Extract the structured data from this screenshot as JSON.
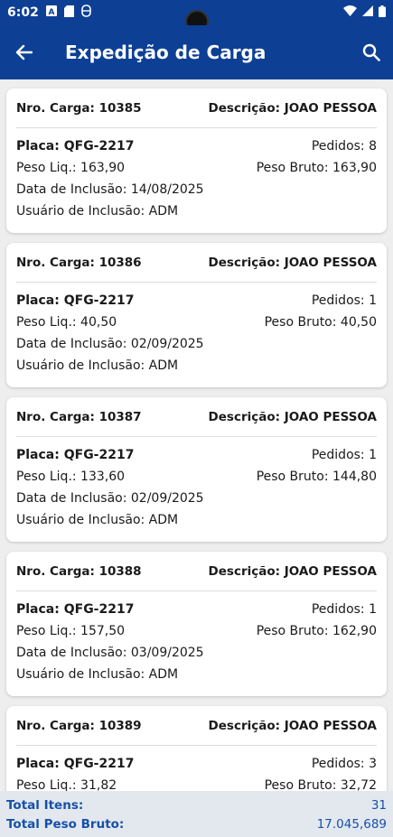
{
  "status": {
    "time": "6:02"
  },
  "header": {
    "title": "Expedição de Carga"
  },
  "cards": [
    {
      "carga": "Nro. Carga: 10385",
      "descricao": "Descrição: JOAO PESSOA",
      "placa": "Placa: QFG-2217",
      "pedidos": "Pedidos: 8",
      "peso_liq": "Peso Liq.: 163,90",
      "peso_bruto": "Peso Bruto: 163,90",
      "data": "Data de Inclusão: 14/08/2025",
      "usuario": "Usuário de Inclusão: ADM"
    },
    {
      "carga": "Nro. Carga: 10386",
      "descricao": "Descrição: JOAO PESSOA",
      "placa": "Placa: QFG-2217",
      "pedidos": "Pedidos: 1",
      "peso_liq": "Peso Liq.: 40,50",
      "peso_bruto": "Peso Bruto: 40,50",
      "data": "Data de Inclusão: 02/09/2025",
      "usuario": "Usuário de Inclusão: ADM"
    },
    {
      "carga": "Nro. Carga: 10387",
      "descricao": "Descrição: JOAO PESSOA",
      "placa": "Placa: QFG-2217",
      "pedidos": "Pedidos: 1",
      "peso_liq": "Peso Liq.: 133,60",
      "peso_bruto": "Peso Bruto: 144,80",
      "data": "Data de Inclusão: 02/09/2025",
      "usuario": "Usuário de Inclusão: ADM"
    },
    {
      "carga": "Nro. Carga: 10388",
      "descricao": "Descrição: JOAO PESSOA",
      "placa": "Placa: QFG-2217",
      "pedidos": "Pedidos: 1",
      "peso_liq": "Peso Liq.: 157,50",
      "peso_bruto": "Peso Bruto: 162,90",
      "data": "Data de Inclusão: 03/09/2025",
      "usuario": "Usuário de Inclusão: ADM"
    },
    {
      "carga": "Nro. Carga: 10389",
      "descricao": "Descrição: JOAO PESSOA",
      "placa": "Placa: QFG-2217",
      "pedidos": "Pedidos: 3",
      "peso_liq": "Peso Liq.: 31,82",
      "peso_bruto": "Peso Bruto: 32,72",
      "data": "",
      "usuario": ""
    }
  ],
  "footer": {
    "total_itens_label": "Total Itens:",
    "total_itens_value": "31",
    "total_peso_label": "Total Peso Bruto:",
    "total_peso_value": "17.045,689"
  },
  "colors": {
    "primary": "#0d3f95",
    "footer_text": "#1650a8",
    "footer_bg": "#e3e8ef"
  },
  "icons": {
    "back": "arrow-left-icon",
    "search": "search-icon",
    "wifi": "wifi-icon",
    "signal": "signal-icon",
    "battery": "battery-icon"
  }
}
